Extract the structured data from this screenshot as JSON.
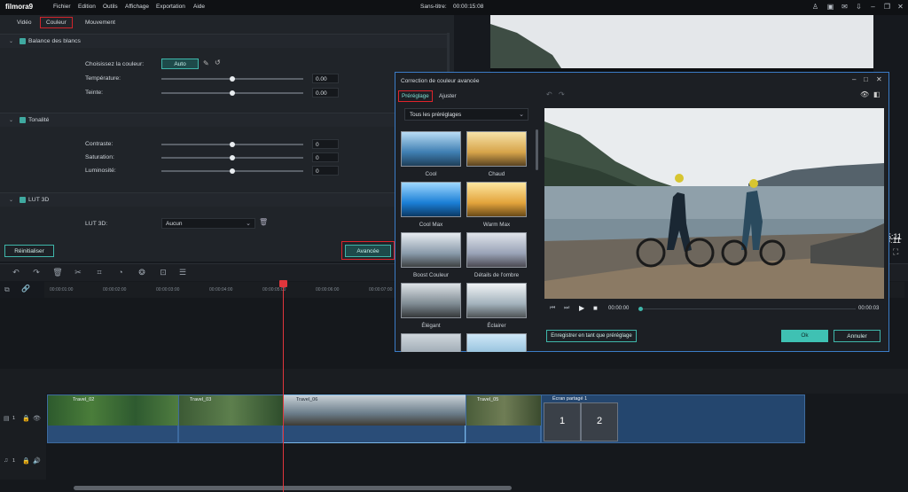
{
  "app": {
    "logo": "filmora9",
    "title": "Sans-titre:",
    "timecode": "00:00:15:08"
  },
  "menu": [
    "Fichier",
    "Edition",
    "Outils",
    "Affichage",
    "Exportation",
    "Aide"
  ],
  "tabs": {
    "video": "Vidéo",
    "couleur": "Couleur",
    "mouvement": "Mouvement"
  },
  "balance": {
    "title": "Balance des blancs",
    "choose": "Choisissez la couleur:",
    "auto": "Auto",
    "temp": "Température:",
    "temp_val": "0.00",
    "teinte": "Teinte:",
    "teinte_val": "0.00"
  },
  "tonalite": {
    "title": "Tonalité",
    "contraste": "Contraste:",
    "contraste_val": "0",
    "saturation": "Saturation:",
    "saturation_val": "0",
    "luminosite": "Luminosité:",
    "luminosite_val": "0"
  },
  "lut": {
    "title": "LUT 3D",
    "label": "LUT 3D:",
    "value": "Aucun"
  },
  "buttons": {
    "reset": "Réinitialiser",
    "advanced": "Avancée"
  },
  "ruler": [
    "00:00:01:00",
    "00:00:02:00",
    "00:00:03:00",
    "00:00:04:00",
    "00:00:05:00",
    "00:00:06:00",
    "00:00:07:00"
  ],
  "track1": {
    "num": "1"
  },
  "track2": {
    "num": "1"
  },
  "clips": {
    "c1": "Travel_02",
    "c2": "Travel_03",
    "c3": "Travel_06",
    "c4": "Travel_05",
    "split": "Écran partagé 1",
    "s1": "1",
    "s2": "2"
  },
  "side_time": "5:11",
  "dialog": {
    "title": "Correction de couleur avancée",
    "tab_preset": "Préréglage",
    "tab_adjust": "Ajuster",
    "dropdown": "Tous les préréglages",
    "presets": [
      "Cool",
      "Chaud",
      "Cool Max",
      "Warm Max",
      "Boost Couleur",
      "Détails de l'ombre",
      "Élégant",
      "Éclairer"
    ],
    "time_start": "00:00:00",
    "time_end": "00:00:03",
    "save": "Enregistrer en tant que préréglage",
    "ok": "Ok",
    "cancel": "Annuler"
  }
}
